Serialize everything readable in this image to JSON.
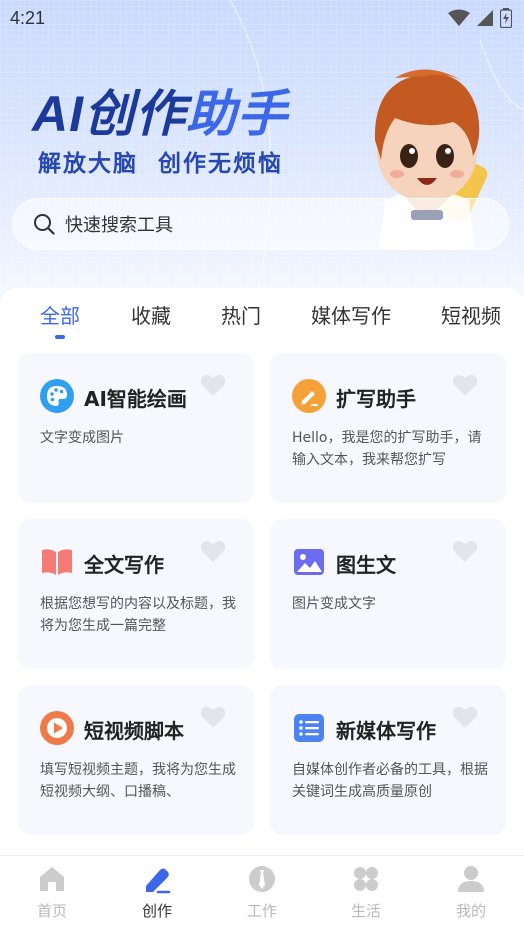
{
  "status_bar": {
    "time": "4:21"
  },
  "hero": {
    "title_part1": "AI创作",
    "title_part2": "助手",
    "subtitle": "解放大脑  创作无烦恼"
  },
  "search": {
    "placeholder": "快速搜索工具"
  },
  "tabs": [
    {
      "label": "全部",
      "active": true
    },
    {
      "label": "收藏"
    },
    {
      "label": "热门"
    },
    {
      "label": "媒体写作"
    },
    {
      "label": "短视频"
    }
  ],
  "cards": [
    {
      "title": "AI智能绘画",
      "icon": "palette-icon",
      "desc": "文字变成图片"
    },
    {
      "title": "扩写助手",
      "icon": "pencil-icon",
      "desc": "Hello，我是您的扩写助手，请输入文本，我来帮您扩写"
    },
    {
      "title": "全文写作",
      "icon": "book-icon",
      "desc": "根据您想写的内容以及标题，我将为您生成一篇完整"
    },
    {
      "title": "图生文",
      "icon": "image-icon",
      "desc": "图片变成文字"
    },
    {
      "title": "短视频脚本",
      "icon": "play-icon",
      "desc": "填写短视频主题，我将为您生成短视频大纲、口播稿、"
    },
    {
      "title": "新媒体写作",
      "icon": "list-icon",
      "desc": "自媒体创作者必备的工具，根据关键词生成高质量原创"
    }
  ],
  "nav": [
    {
      "label": "首页",
      "icon": "home-icon"
    },
    {
      "label": "创作",
      "icon": "create-icon",
      "active": true
    },
    {
      "label": "工作",
      "icon": "work-icon"
    },
    {
      "label": "生活",
      "icon": "life-icon"
    },
    {
      "label": "我的",
      "icon": "profile-icon"
    }
  ],
  "colors": {
    "accent": "#3b67e8",
    "title_dark": "#1f3d9e",
    "nav_inactive": "#cccccc"
  }
}
